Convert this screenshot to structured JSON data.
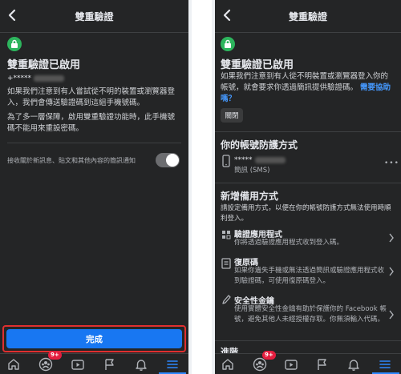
{
  "left": {
    "header": {
      "title": "雙重驗證"
    },
    "heading": "雙重驗證已啟用",
    "phone_masked": "+*****",
    "body1": "如果我們注意到有人嘗試從不明的裝置或瀏覽器登入，我們會傳送驗證碼到這組手機號碼。",
    "body2": "為了多一層保障，啟用雙重驗證功能時，此手機號碼不能用來重設密碼。",
    "toggle_label": "接收關於新訊息、貼文和其他內容的簡訊通知",
    "toggle_state": "off",
    "done_button": "完成",
    "tabs": {
      "groups_badge": "9+"
    }
  },
  "right": {
    "header": {
      "title": "雙重驗證"
    },
    "heading": "雙重驗證已啟用",
    "body": "如果我們注意到有人從不明裝置或瀏覽器登入你的帳號，就會要求你透過簡訊提供驗證碼。",
    "help_link": "需要協助嗎？",
    "close_button": "關閉",
    "protection_heading": "你的帳號防護方式",
    "phone_masked": "*****",
    "sms_label": "簡訊 (SMS)",
    "more_icon_text": "•••",
    "backup_heading": "新增備用方式",
    "backup_desc": "請設定備用方式，以便在你的帳號防護方式無法使用時順利登入。",
    "methods": [
      {
        "title": "驗證應用程式",
        "desc": "你將透過驗證應用程式收到登入碼。"
      },
      {
        "title": "復原碼",
        "desc": "如果你遺失手機或無法透過簡訊或驗證應用程式收到驗證碼，可使用復原碼登入。"
      },
      {
        "title": "安全性金鑰",
        "desc": "使用實體安全性金鑰有助於保護你的 Facebook 帳號，避免其他人未經授權存取。你無須輸入代碼。"
      }
    ],
    "advanced_heading": "進階",
    "tabs": {
      "groups_badge": "9+"
    }
  },
  "colors": {
    "background": "#242526",
    "accent": "#1877f2",
    "link": "#4599ff",
    "lock_green": "#2db55d",
    "highlight_red": "#e02f2f",
    "badge_red": "#e41e3f"
  },
  "icons": [
    "back-arrow-icon",
    "lock-icon",
    "phone-icon",
    "app-icon",
    "key-list-icon",
    "pencil-key-icon",
    "chevron-right-icon",
    "home-icon",
    "groups-icon",
    "video-icon",
    "flag-icon",
    "bell-icon",
    "menu-icon"
  ]
}
